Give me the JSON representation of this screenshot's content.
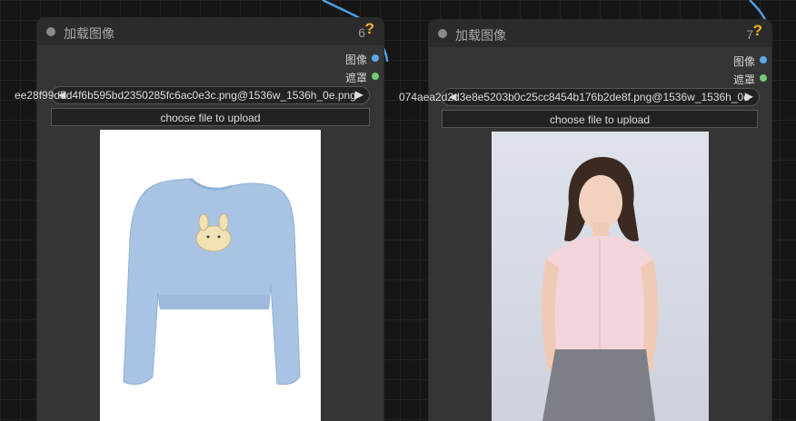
{
  "nodes": [
    {
      "title": "加载图像",
      "id": "6",
      "outputs": {
        "image": "图像",
        "mask": "遮罩"
      },
      "image_value": "ee28f99d5d4f6b595bd2350285fc6ac0e3c.png@1536w_1536h_0e.png",
      "upload_label": "choose file to upload"
    },
    {
      "title": "加载图像",
      "id": "7",
      "outputs": {
        "image": "图像",
        "mask": "遮罩"
      },
      "image_value": "074aea2d2d3e8e5203b0c25cc8454b176b2de8f.png@1536w_1536h_0e",
      "upload_label": "choose file to upload"
    }
  ],
  "colors": {
    "image_slot": "#5ea8e8",
    "mask_slot": "#79c97a",
    "wire": "#4f9fe0",
    "help": "#f3b62a"
  },
  "icons": {
    "collapse": "circle-dot-icon",
    "help": "question-mark-icon",
    "prev": "triangle-left-icon",
    "next": "triangle-right-icon"
  }
}
